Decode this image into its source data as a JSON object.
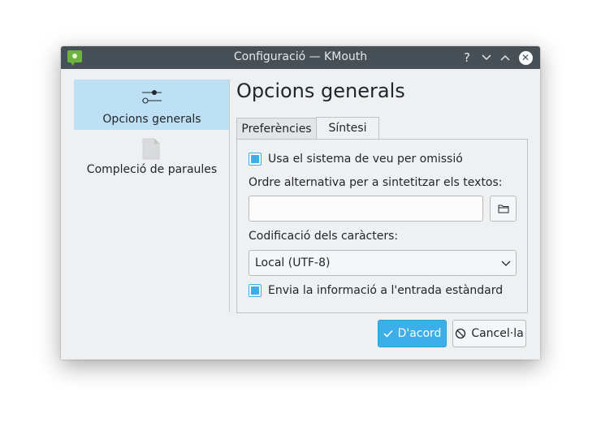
{
  "window": {
    "title": "Configuració — KMouth",
    "controls": {
      "help": "?",
      "minimize": "⌄",
      "maximize": "⌃",
      "close": "✕"
    }
  },
  "sidebar": {
    "items": [
      {
        "label": "Opcions generals",
        "icon": "sliders-icon",
        "selected": true
      },
      {
        "label": "Compleció de paraules",
        "icon": "document-icon",
        "selected": false
      }
    ]
  },
  "page": {
    "title": "Opcions generals",
    "tabs": [
      {
        "label": "Preferències",
        "active": false
      },
      {
        "label": "Síntesi",
        "active": true
      }
    ]
  },
  "synthesis": {
    "use_default_voice": {
      "label": "Usa el sistema de veu per omissió",
      "checked": true
    },
    "alt_command_label": "Ordre alternativa per a sintetitzar els textos:",
    "alt_command_value": "",
    "encoding_label": "Codificació dels caràcters:",
    "encoding_selected": "Local (UTF-8)",
    "send_stdin": {
      "label": "Envia la informació a l'entrada estàndard",
      "checked": true
    }
  },
  "buttons": {
    "ok": "D'acord",
    "cancel": "Cancel·la"
  },
  "colors": {
    "accent": "#3daee9",
    "titlebar": "#475057",
    "window_bg": "#eff0f1",
    "selection": "#bde0f4"
  }
}
